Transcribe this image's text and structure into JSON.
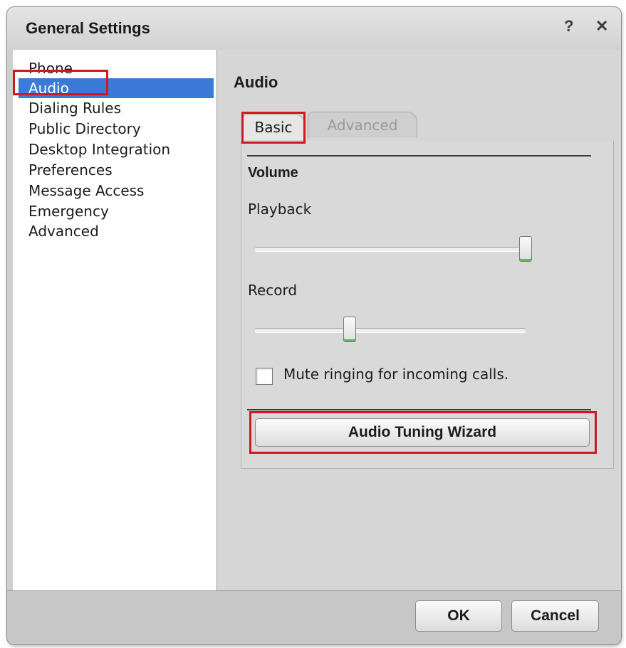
{
  "dialog": {
    "title": "General Settings",
    "help_glyph": "?",
    "close_glyph": "✕"
  },
  "nav": {
    "items": [
      {
        "label": "Phone"
      },
      {
        "label": "Audio",
        "selected": true
      },
      {
        "label": "Dialing Rules"
      },
      {
        "label": "Public Directory"
      },
      {
        "label": "Desktop Integration"
      },
      {
        "label": "Preferences"
      },
      {
        "label": "Message Access"
      },
      {
        "label": "Emergency"
      },
      {
        "label": "Advanced"
      }
    ]
  },
  "content": {
    "title": "Audio",
    "tabs": [
      {
        "label": "Basic",
        "active": true
      },
      {
        "label": "Advanced",
        "active": false
      }
    ],
    "volume": {
      "heading": "Volume",
      "playback": {
        "label": "Playback",
        "level": 1.0
      },
      "record": {
        "label": "Record",
        "level": 0.35
      }
    },
    "mute_ringing": {
      "label": "Mute ringing for incoming calls.",
      "checked": false
    },
    "wizard_button": "Audio Tuning Wizard"
  },
  "footer": {
    "ok_label": "OK",
    "cancel_label": "Cancel"
  },
  "colors": {
    "selection": "#3b7ad6",
    "highlight_box": "#d0181e",
    "thumb_accent": "#5cba5c"
  },
  "icons": {
    "help": "help-icon",
    "close": "close-icon",
    "checkbox": "checkbox-unchecked"
  }
}
